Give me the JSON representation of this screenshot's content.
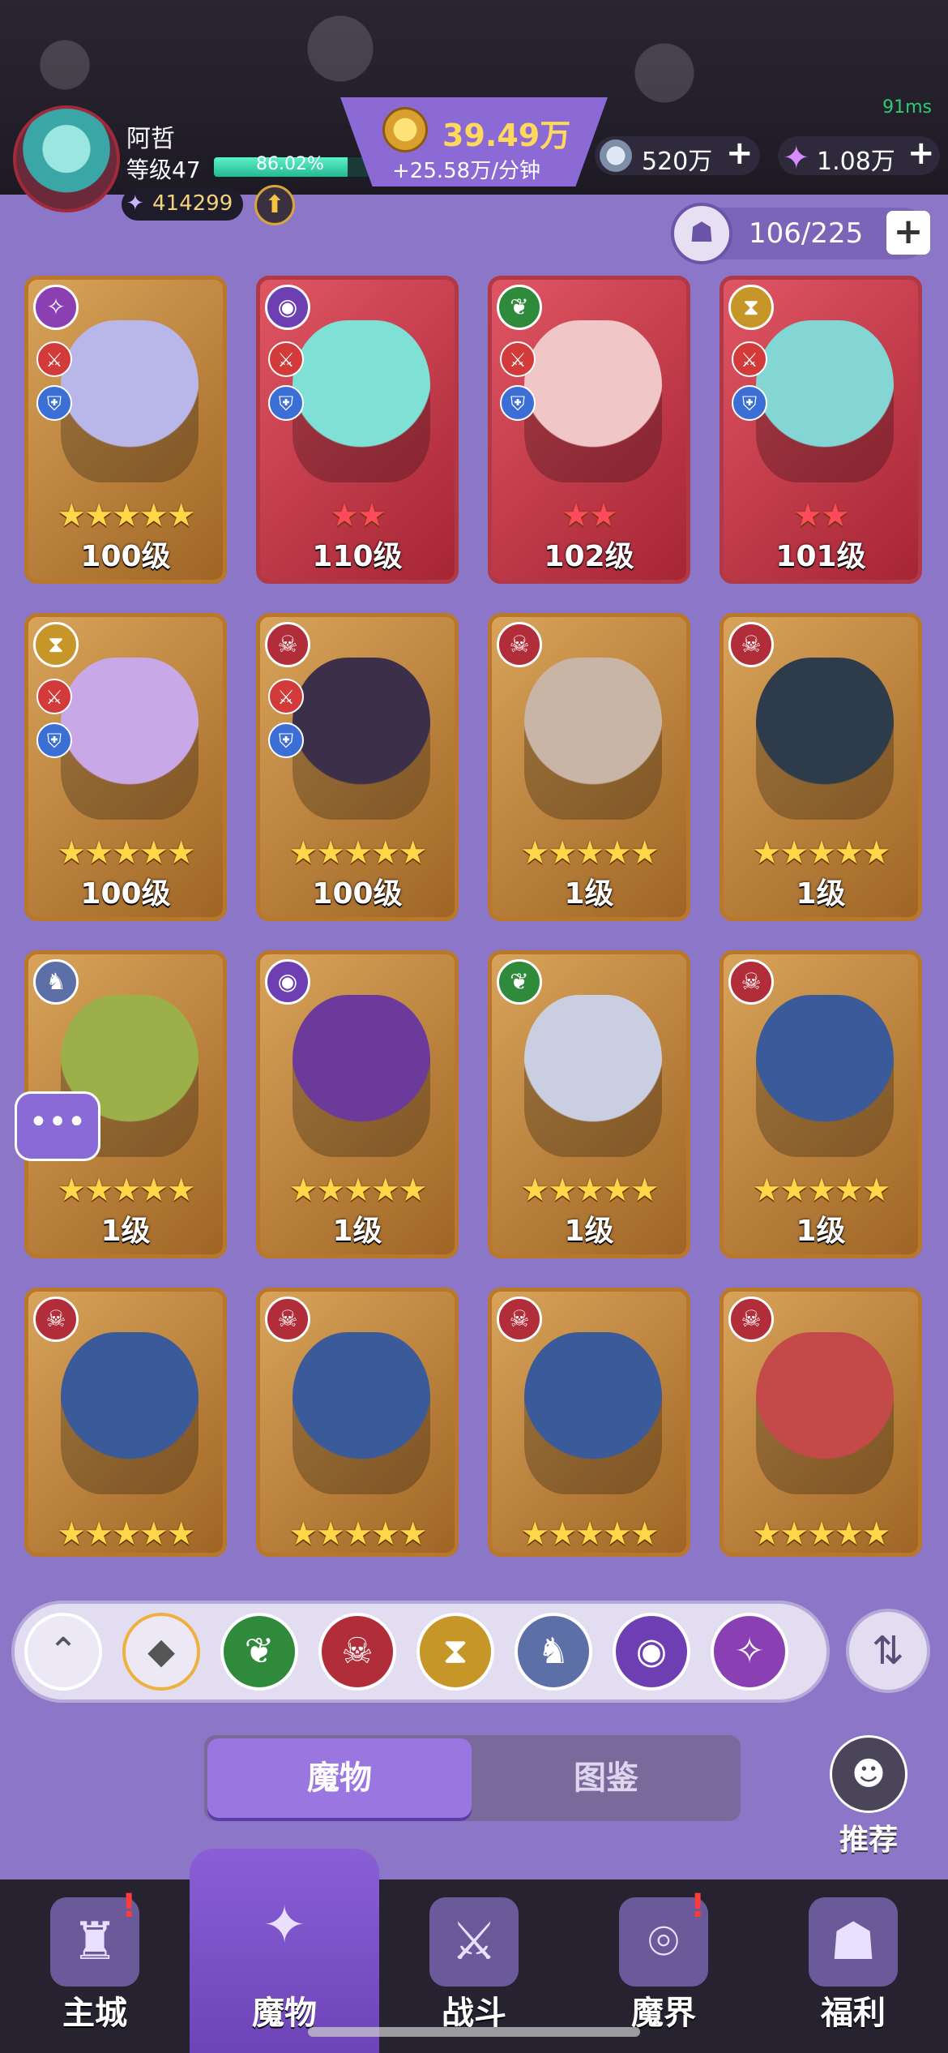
{
  "status": {
    "ping": "91ms"
  },
  "player": {
    "name": "阿哲",
    "level_label": "等级47",
    "exp_percent": "86.02%",
    "exp_fraction": 0.8602,
    "power": "414299"
  },
  "resources": {
    "gold": "39.49万",
    "gold_rate": "+25.58万/分钟",
    "silver": "520万",
    "crystal": "1.08万"
  },
  "collection": {
    "count": "106/225"
  },
  "cards": [
    {
      "faction": "chaos",
      "stars": 5,
      "stars_text": "★★★★★",
      "level": "100级",
      "frame": "gold",
      "roles": true
    },
    {
      "faction": "arcane",
      "stars": 2,
      "stars_text": "★★",
      "level": "110级",
      "frame": "red",
      "roles": true
    },
    {
      "faction": "nature",
      "stars": 2,
      "stars_text": "★★",
      "level": "102级",
      "frame": "red",
      "roles": true
    },
    {
      "faction": "time",
      "stars": 2,
      "stars_text": "★★",
      "level": "101级",
      "frame": "red",
      "roles": true
    },
    {
      "faction": "time",
      "stars": 5,
      "stars_text": "★★★★★",
      "level": "100级",
      "frame": "gold",
      "roles": true
    },
    {
      "faction": "inferno",
      "stars": 5,
      "stars_text": "★★★★★",
      "level": "100级",
      "frame": "gold",
      "roles": true
    },
    {
      "faction": "inferno",
      "stars": 5,
      "stars_text": "★★★★★",
      "level": "1级",
      "frame": "gold",
      "roles": false
    },
    {
      "faction": "inferno",
      "stars": 5,
      "stars_text": "★★★★★",
      "level": "1级",
      "frame": "gold",
      "roles": false
    },
    {
      "faction": "dragon",
      "stars": 5,
      "stars_text": "★★★★★",
      "level": "1级",
      "frame": "gold",
      "roles": false
    },
    {
      "faction": "arcane",
      "stars": 5,
      "stars_text": "★★★★★",
      "level": "1级",
      "frame": "gold",
      "roles": false
    },
    {
      "faction": "nature",
      "stars": 5,
      "stars_text": "★★★★★",
      "level": "1级",
      "frame": "gold",
      "roles": false
    },
    {
      "faction": "inferno",
      "stars": 5,
      "stars_text": "★★★★★",
      "level": "1级",
      "frame": "gold",
      "roles": false
    },
    {
      "faction": "inferno",
      "stars": 5,
      "stars_text": "★★★★★",
      "level": "",
      "frame": "gold",
      "roles": false
    },
    {
      "faction": "inferno",
      "stars": 5,
      "stars_text": "★★★★★",
      "level": "",
      "frame": "gold",
      "roles": false
    },
    {
      "faction": "inferno",
      "stars": 5,
      "stars_text": "★★★★★",
      "level": "",
      "frame": "gold",
      "roles": false
    },
    {
      "faction": "inferno",
      "stars": 5,
      "stars_text": "★★★★★",
      "level": "",
      "frame": "gold",
      "roles": false
    }
  ],
  "filters": [
    "collapse-icon",
    "all-icon",
    "nature-icon",
    "inferno-icon",
    "time-icon",
    "dragon-icon",
    "arcane-icon",
    "chaos-icon"
  ],
  "tabs": {
    "monsters": "魔物",
    "codex": "图鉴"
  },
  "recommend": "推荐",
  "nav": [
    {
      "label": "主城",
      "icon": "castle-icon",
      "alert": true
    },
    {
      "label": "魔物",
      "icon": "monster-icon",
      "active": true
    },
    {
      "label": "战斗",
      "icon": "sword-icon"
    },
    {
      "label": "魔界",
      "icon": "portal-icon",
      "alert": true
    },
    {
      "label": "福利",
      "icon": "chest-icon"
    }
  ]
}
